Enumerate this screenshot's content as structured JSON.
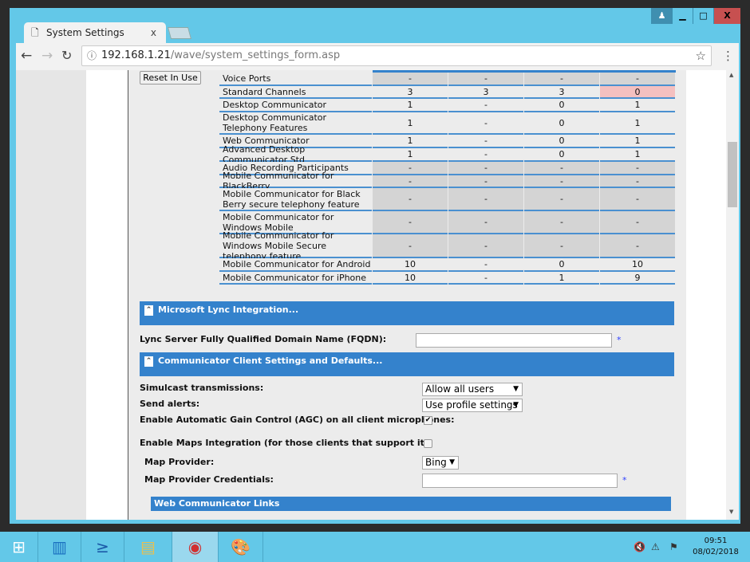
{
  "browser": {
    "tab_title": "System Settings",
    "url_host": "192.168.1.21",
    "url_path": "/wave/system_settings_form.asp",
    "close": "x"
  },
  "window_controls": {
    "minimize": "▁",
    "maximize": "□",
    "close": "X"
  },
  "reset_button": "Reset In Use",
  "table": {
    "rows": [
      {
        "label": "Voice Ports",
        "values": [
          "-",
          "-",
          "-",
          "-"
        ],
        "grey": true
      },
      {
        "label": "Standard Channels",
        "values": [
          "3",
          "3",
          "3",
          "0"
        ],
        "grey": false,
        "highlight_last": true
      },
      {
        "label": "Desktop Communicator",
        "values": [
          "1",
          "-",
          "0",
          "1"
        ],
        "grey": false
      },
      {
        "label": "Desktop Communicator Telephony Features",
        "values": [
          "1",
          "-",
          "0",
          "1"
        ],
        "grey": false
      },
      {
        "label": "Web Communicator",
        "values": [
          "1",
          "-",
          "0",
          "1"
        ],
        "grey": false
      },
      {
        "label": "Advanced Desktop Communicator Std",
        "values": [
          "1",
          "-",
          "0",
          "1"
        ],
        "grey": false
      },
      {
        "label": "Audio Recording Participants",
        "values": [
          "-",
          "-",
          "-",
          "-"
        ],
        "grey": true
      },
      {
        "label": "Mobile Communicator for BlackBerry",
        "values": [
          "-",
          "-",
          "-",
          "-"
        ],
        "grey": true
      },
      {
        "label": "Mobile Communicator for Black Berry secure telephony feature",
        "values": [
          "-",
          "-",
          "-",
          "-"
        ],
        "grey": true
      },
      {
        "label": "Mobile Communicator for Windows Mobile",
        "values": [
          "-",
          "-",
          "-",
          "-"
        ],
        "grey": true
      },
      {
        "label": "Mobile Communicator for Windows Mobile Secure telephony feature",
        "values": [
          "-",
          "-",
          "-",
          "-"
        ],
        "grey": true
      },
      {
        "label": "Mobile Communicator for Android",
        "values": [
          "10",
          "-",
          "0",
          "10"
        ],
        "grey": false
      },
      {
        "label": "Mobile Communicator for iPhone",
        "values": [
          "10",
          "-",
          "1",
          "9"
        ],
        "grey": false
      }
    ]
  },
  "lync": {
    "header": "Microsoft Lync Integration...",
    "fqdn_label": "Lync Server Fully Qualified Domain Name (FQDN):",
    "fqdn_value": "",
    "required": "*"
  },
  "client": {
    "header": "Communicator Client Settings and Defaults...",
    "simulcast_label": "Simulcast transmissions:",
    "simulcast_value": "Allow all users",
    "alerts_label": "Send alerts:",
    "alerts_value": "Use profile settings",
    "agc_label": "Enable Automatic Gain Control (AGC) on all client microphones:",
    "agc_checked": true,
    "maps_label": "Enable Maps Integration (for those clients that support it):",
    "maps_checked": false,
    "provider_label": "Map Provider:",
    "provider_value": "Bing",
    "credentials_label": "Map Provider Credentials:",
    "credentials_value": "",
    "required": "*",
    "web_links_header": "Web Communicator Links"
  },
  "taskbar": {
    "time": "09:51",
    "date": "08/02/2018"
  },
  "colors": {
    "accent": "#3482cc",
    "chrome": "#63c8e8",
    "highlight": "#f4c0c0",
    "grey_cell": "#d4d4d4"
  }
}
